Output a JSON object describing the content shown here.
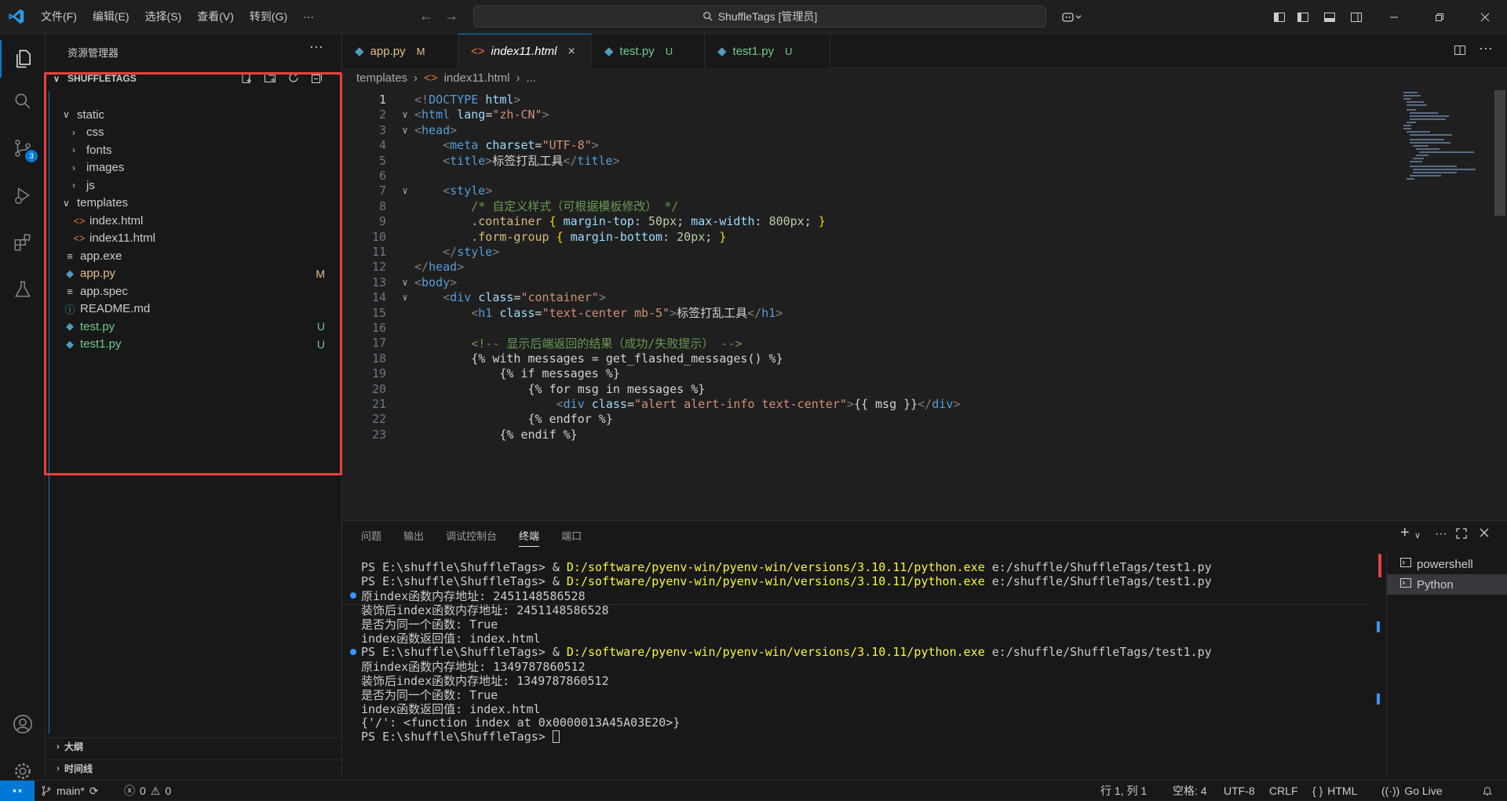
{
  "menu": [
    "文件(F)",
    "编辑(E)",
    "选择(S)",
    "查看(V)",
    "转到(G)",
    "···"
  ],
  "search": {
    "text": "ShuffleTags [管理员]"
  },
  "activity": {
    "scm_badge": "3"
  },
  "sidebar": {
    "title": "资源管理器",
    "more": "···",
    "root": "SHUFFLETAGS",
    "tree": [
      {
        "label": "static",
        "kind": "folder-open",
        "depth": 1
      },
      {
        "label": "css",
        "kind": "folder",
        "depth": 2
      },
      {
        "label": "fonts",
        "kind": "folder",
        "depth": 2
      },
      {
        "label": "images",
        "kind": "folder",
        "depth": 2
      },
      {
        "label": "js",
        "kind": "folder",
        "depth": 2
      },
      {
        "label": "templates",
        "kind": "folder-open",
        "depth": 1
      },
      {
        "label": "index.html",
        "kind": "html",
        "depth": 2
      },
      {
        "label": "index11.html",
        "kind": "html",
        "depth": 2
      },
      {
        "label": "app.exe",
        "kind": "file",
        "depth": 1
      },
      {
        "label": "app.py",
        "kind": "py",
        "depth": 1,
        "status": "M",
        "color": "#e2c08d"
      },
      {
        "label": "app.spec",
        "kind": "file",
        "depth": 1
      },
      {
        "label": "README.md",
        "kind": "info",
        "depth": 1
      },
      {
        "label": "test.py",
        "kind": "py",
        "depth": 1,
        "status": "U",
        "color": "#73c991"
      },
      {
        "label": "test1.py",
        "kind": "py",
        "depth": 1,
        "status": "U",
        "color": "#73c991"
      }
    ],
    "outline": "大纲",
    "timeline": "时间线"
  },
  "tabs": [
    {
      "label": "app.py",
      "status": "M",
      "status_color": "#e2c08d",
      "label_color": "#e2c08d",
      "icon": "py"
    },
    {
      "label": "index11.html",
      "status": "×",
      "active": true,
      "icon": "html"
    },
    {
      "label": "test.py",
      "status": "U",
      "status_color": "#73c991",
      "label_color": "#73c991",
      "icon": "py"
    },
    {
      "label": "test1.py",
      "status": "U",
      "status_color": "#73c991",
      "label_color": "#73c991",
      "icon": "py"
    }
  ],
  "breadcrumb": [
    "templates",
    "index11.html",
    "..."
  ],
  "code": [
    {
      "n": "1",
      "fold": "",
      "indent": 0,
      "parts": [
        [
          "c-br",
          "<!"
        ],
        [
          "c-tag",
          "DOCTYPE"
        ],
        [
          "c-txt",
          " "
        ],
        [
          "c-attr",
          "html"
        ],
        [
          "c-br",
          ">"
        ]
      ]
    },
    {
      "n": "2",
      "fold": "v",
      "indent": 0,
      "parts": [
        [
          "c-br",
          "<"
        ],
        [
          "c-tag",
          "html"
        ],
        [
          "c-txt",
          " "
        ],
        [
          "c-attr",
          "lang"
        ],
        [
          "c-txt",
          "="
        ],
        [
          "c-str",
          "\"zh-CN\""
        ],
        [
          "c-br",
          ">"
        ]
      ]
    },
    {
      "n": "3",
      "fold": "v",
      "indent": 0,
      "parts": [
        [
          "c-br",
          "<"
        ],
        [
          "c-tag",
          "head"
        ],
        [
          "c-br",
          ">"
        ]
      ]
    },
    {
      "n": "4",
      "fold": "",
      "indent": 1,
      "parts": [
        [
          "c-br",
          "<"
        ],
        [
          "c-tag",
          "meta"
        ],
        [
          "c-txt",
          " "
        ],
        [
          "c-attr",
          "charset"
        ],
        [
          "c-txt",
          "="
        ],
        [
          "c-str",
          "\"UTF-8\""
        ],
        [
          "c-br",
          ">"
        ]
      ]
    },
    {
      "n": "5",
      "fold": "",
      "indent": 1,
      "parts": [
        [
          "c-br",
          "<"
        ],
        [
          "c-tag",
          "title"
        ],
        [
          "c-br",
          ">"
        ],
        [
          "c-txt",
          "标签打乱工具"
        ],
        [
          "c-br",
          "</"
        ],
        [
          "c-tag",
          "title"
        ],
        [
          "c-br",
          ">"
        ]
      ]
    },
    {
      "n": "6",
      "fold": "",
      "indent": 0,
      "parts": []
    },
    {
      "n": "7",
      "fold": "v",
      "indent": 1,
      "parts": [
        [
          "c-br",
          "<"
        ],
        [
          "c-tag",
          "style"
        ],
        [
          "c-br",
          ">"
        ]
      ]
    },
    {
      "n": "8",
      "fold": "",
      "indent": 2,
      "parts": [
        [
          "c-com",
          "/* 自定义样式（可根据模板修改） */"
        ]
      ]
    },
    {
      "n": "9",
      "fold": "",
      "indent": 2,
      "parts": [
        [
          "c-sel",
          ".container"
        ],
        [
          "c-txt",
          " "
        ],
        [
          "c-brace",
          "{"
        ],
        [
          "c-txt",
          " "
        ],
        [
          "c-prop",
          "margin-top"
        ],
        [
          "c-txt",
          ": "
        ],
        [
          "c-num",
          "50px"
        ],
        [
          "c-txt",
          "; "
        ],
        [
          "c-prop",
          "max-width"
        ],
        [
          "c-txt",
          ": "
        ],
        [
          "c-num",
          "800px"
        ],
        [
          "c-txt",
          "; "
        ],
        [
          "c-brace",
          "}"
        ]
      ]
    },
    {
      "n": "10",
      "fold": "",
      "indent": 2,
      "parts": [
        [
          "c-sel",
          ".form-group"
        ],
        [
          "c-txt",
          " "
        ],
        [
          "c-brace",
          "{"
        ],
        [
          "c-txt",
          " "
        ],
        [
          "c-prop",
          "margin-bottom"
        ],
        [
          "c-txt",
          ": "
        ],
        [
          "c-num",
          "20px"
        ],
        [
          "c-txt",
          "; "
        ],
        [
          "c-brace",
          "}"
        ]
      ]
    },
    {
      "n": "11",
      "fold": "",
      "indent": 1,
      "parts": [
        [
          "c-br",
          "</"
        ],
        [
          "c-tag",
          "style"
        ],
        [
          "c-br",
          ">"
        ]
      ]
    },
    {
      "n": "12",
      "fold": "",
      "indent": 0,
      "parts": [
        [
          "c-br",
          "</"
        ],
        [
          "c-tag",
          "head"
        ],
        [
          "c-br",
          ">"
        ]
      ]
    },
    {
      "n": "13",
      "fold": "v",
      "indent": 0,
      "parts": [
        [
          "c-br",
          "<"
        ],
        [
          "c-tag",
          "body"
        ],
        [
          "c-br",
          ">"
        ]
      ]
    },
    {
      "n": "14",
      "fold": "v",
      "indent": 1,
      "parts": [
        [
          "c-br",
          "<"
        ],
        [
          "c-tag",
          "div"
        ],
        [
          "c-txt",
          " "
        ],
        [
          "c-attr",
          "class"
        ],
        [
          "c-txt",
          "="
        ],
        [
          "c-str",
          "\"container\""
        ],
        [
          "c-br",
          ">"
        ]
      ]
    },
    {
      "n": "15",
      "fold": "",
      "indent": 2,
      "parts": [
        [
          "c-br",
          "<"
        ],
        [
          "c-tag",
          "h1"
        ],
        [
          "c-txt",
          " "
        ],
        [
          "c-attr",
          "class"
        ],
        [
          "c-txt",
          "="
        ],
        [
          "c-str",
          "\"text-center mb-5\""
        ],
        [
          "c-br",
          ">"
        ],
        [
          "c-txt",
          "标签打乱工具"
        ],
        [
          "c-br",
          "</"
        ],
        [
          "c-tag",
          "h1"
        ],
        [
          "c-br",
          ">"
        ]
      ]
    },
    {
      "n": "16",
      "fold": "",
      "indent": 0,
      "parts": []
    },
    {
      "n": "17",
      "fold": "",
      "indent": 2,
      "parts": [
        [
          "c-com",
          "<!-- 显示后端返回的结果（成功/失败提示） -->"
        ]
      ]
    },
    {
      "n": "18",
      "fold": "",
      "indent": 2,
      "parts": [
        [
          "c-txt",
          "{% with messages = get_flashed_messages() %}"
        ]
      ]
    },
    {
      "n": "19",
      "fold": "",
      "indent": 3,
      "parts": [
        [
          "c-txt",
          "{% if messages %}"
        ]
      ]
    },
    {
      "n": "20",
      "fold": "",
      "indent": 4,
      "parts": [
        [
          "c-txt",
          "{% for msg in messages %}"
        ]
      ]
    },
    {
      "n": "21",
      "fold": "",
      "indent": 5,
      "parts": [
        [
          "c-br",
          "<"
        ],
        [
          "c-tag",
          "div"
        ],
        [
          "c-txt",
          " "
        ],
        [
          "c-attr",
          "class"
        ],
        [
          "c-txt",
          "="
        ],
        [
          "c-str",
          "\"alert alert-info text-center\""
        ],
        [
          "c-br",
          ">"
        ],
        [
          "c-txt",
          "{{ msg }}"
        ],
        [
          "c-br",
          "</"
        ],
        [
          "c-tag",
          "div"
        ],
        [
          "c-br",
          ">"
        ]
      ]
    },
    {
      "n": "22",
      "fold": "",
      "indent": 4,
      "parts": [
        [
          "c-txt",
          "{% endfor %}"
        ]
      ]
    },
    {
      "n": "23",
      "fold": "",
      "indent": 3,
      "parts": [
        [
          "c-txt",
          "{% endif %}"
        ]
      ]
    }
  ],
  "panel": {
    "tabs": [
      "问题",
      "输出",
      "调试控制台",
      "终端",
      "端口"
    ],
    "active_tab": "终端",
    "terminal_lines": [
      {
        "dot": false,
        "parts": [
          [
            "",
            "PS E:\\shuffle\\ShuffleTags> & "
          ],
          [
            "t-y",
            "D:/software/pyenv-win/pyenv-win/versions/3.10.11/python.exe"
          ],
          [
            "",
            " e:/shuffle/ShuffleTags/test1.py"
          ]
        ]
      },
      {
        "dot": false,
        "parts": [
          [
            "",
            "PS E:\\shuffle\\ShuffleTags> & "
          ],
          [
            "t-y",
            "D:/software/pyenv-win/pyenv-win/versions/3.10.11/python.exe"
          ],
          [
            "",
            " e:/shuffle/ShuffleTags/test1.py"
          ]
        ]
      },
      {
        "dot": true,
        "parts": [
          [
            "",
            "原index函数内存地址: 2451148586528"
          ]
        ]
      },
      {
        "dot": false,
        "parts": [
          [
            "",
            "装饰后index函数内存地址: 2451148586528"
          ]
        ]
      },
      {
        "dot": false,
        "parts": [
          [
            "",
            "是否为同一个函数: True"
          ]
        ]
      },
      {
        "dot": false,
        "parts": [
          [
            "",
            "index函数返回值: index.html"
          ]
        ]
      },
      {
        "dot": true,
        "parts": [
          [
            "",
            "PS E:\\shuffle\\ShuffleTags> & "
          ],
          [
            "t-y",
            "D:/software/pyenv-win/pyenv-win/versions/3.10.11/python.exe"
          ],
          [
            "",
            " e:/shuffle/ShuffleTags/test1.py"
          ]
        ]
      },
      {
        "dot": false,
        "parts": [
          [
            "",
            "原index函数内存地址: 1349787860512"
          ]
        ]
      },
      {
        "dot": false,
        "parts": [
          [
            "",
            "装饰后index函数内存地址: 1349787860512"
          ]
        ]
      },
      {
        "dot": false,
        "parts": [
          [
            "",
            "是否为同一个函数: True"
          ]
        ]
      },
      {
        "dot": false,
        "parts": [
          [
            "",
            "index函数返回值: index.html"
          ]
        ]
      },
      {
        "dot": false,
        "parts": [
          [
            "",
            "{'/': <function index at 0x0000013A45A03E20>}"
          ]
        ]
      },
      {
        "dot": false,
        "parts": [
          [
            "",
            "PS E:\\shuffle\\ShuffleTags> "
          ]
        ]
      }
    ],
    "terminals": [
      "powershell",
      "Python"
    ],
    "active_terminal": "Python"
  },
  "status": {
    "branch": "main*",
    "errors": "0",
    "warnings": "0",
    "position": "行 1, 列 1",
    "spaces": "空格: 4",
    "encoding": "UTF-8",
    "eol": "CRLF",
    "language": "HTML",
    "golive": "Go Live"
  }
}
